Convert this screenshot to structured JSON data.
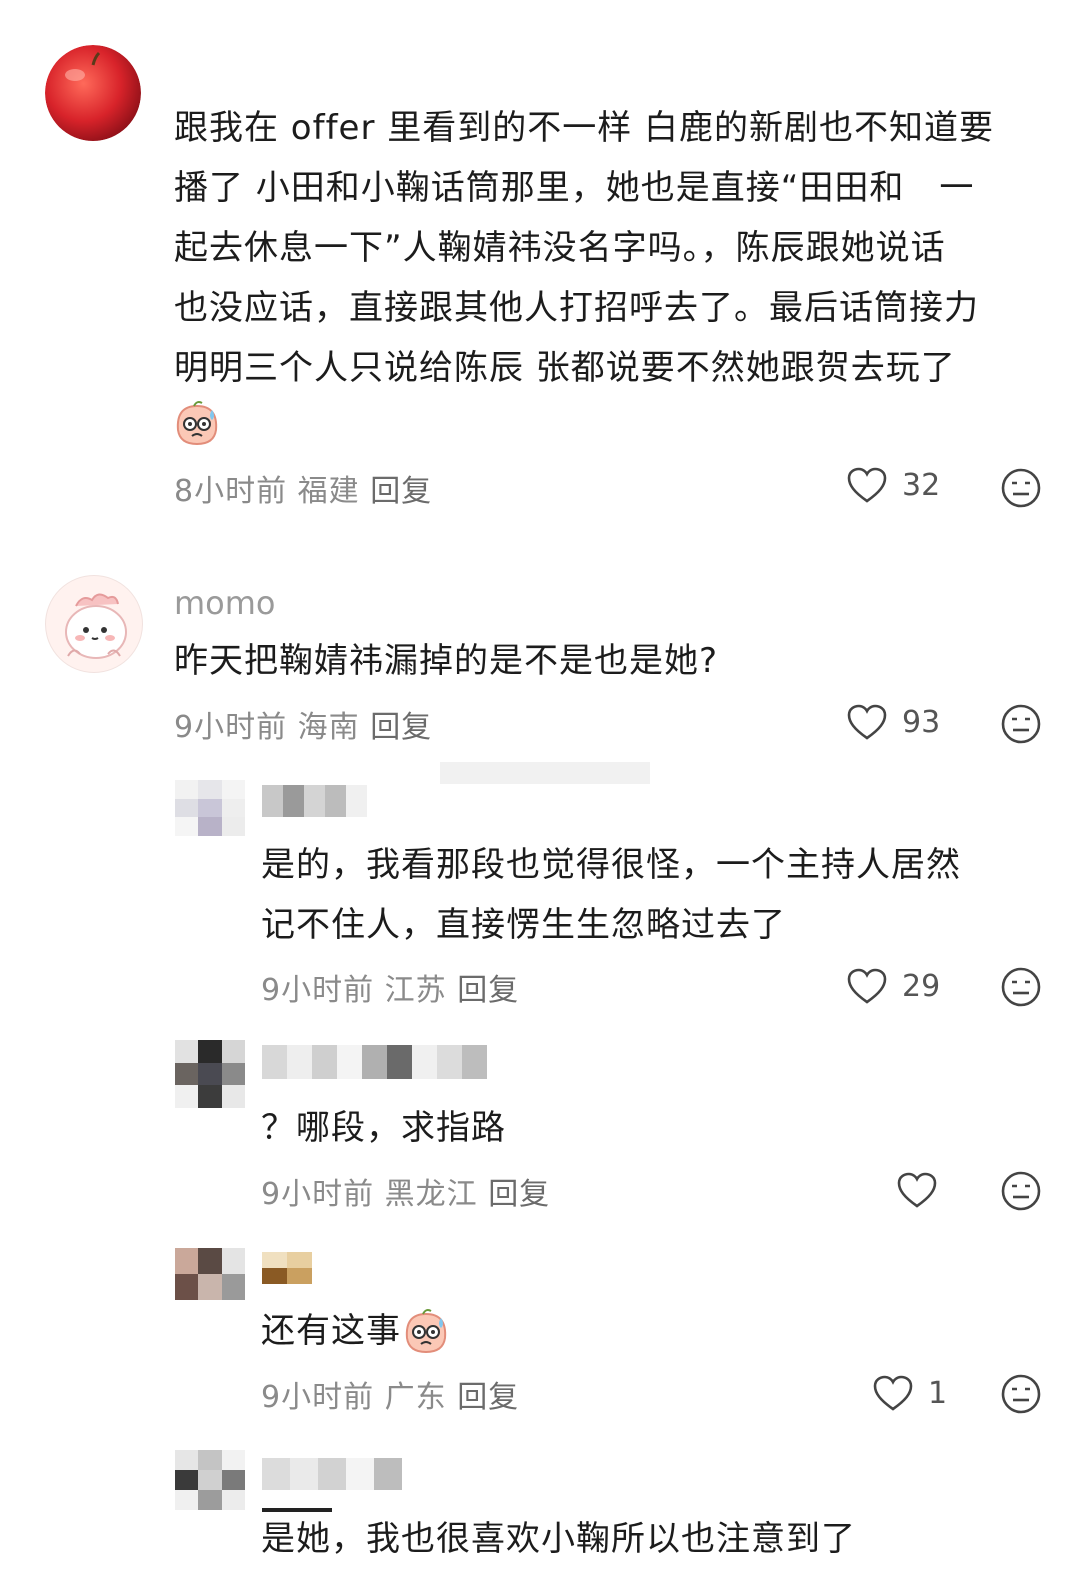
{
  "comments": [
    {
      "text_lines": [
        "跟我在 offer 里看到的不一样 白鹿的新剧也不知道要",
        "播了 小田和小鞠话筒那里，她也是直接“田田和　一",
        "起去休息一下”人鞠婧祎没名字吗。，陈辰跟她说话",
        "也没应话，直接跟其他人打招呼去了。最后话筒接力",
        "明明三个人只说给陈辰 张都说要不然她跟贺去玩了"
      ],
      "time": "8小时前",
      "location": "福建",
      "reply": "回复",
      "likes": "32"
    },
    {
      "username": "momo",
      "text": "昨天把鞠婧祎漏掉的是不是也是她?",
      "time": "9小时前",
      "location": "海南",
      "reply": "回复",
      "likes": "93"
    }
  ],
  "replies": [
    {
      "text_lines": [
        "是的，我看那段也觉得很怪，一个主持人居然",
        "记不住人，直接愣生生忽略过去了"
      ],
      "time": "9小时前",
      "location": "江苏",
      "reply": "回复",
      "likes": "29"
    },
    {
      "text": "？哪段，求指路",
      "time": "9小时前",
      "location": "黑龙江",
      "reply": "回复"
    },
    {
      "text": "还有这事",
      "time": "9小时前",
      "location": "广东",
      "reply": "回复",
      "likes": "1"
    },
    {
      "text": "是她，我也很喜欢小鞠所以也注意到了"
    }
  ],
  "icons": {
    "like": "heart-outline-icon",
    "dislike": "meh-face-icon",
    "sticker": "sweat-peach-sticker"
  },
  "colors": {
    "text": "#1c1c1c",
    "meta": "#8a8a8a",
    "icon": "#444444"
  }
}
